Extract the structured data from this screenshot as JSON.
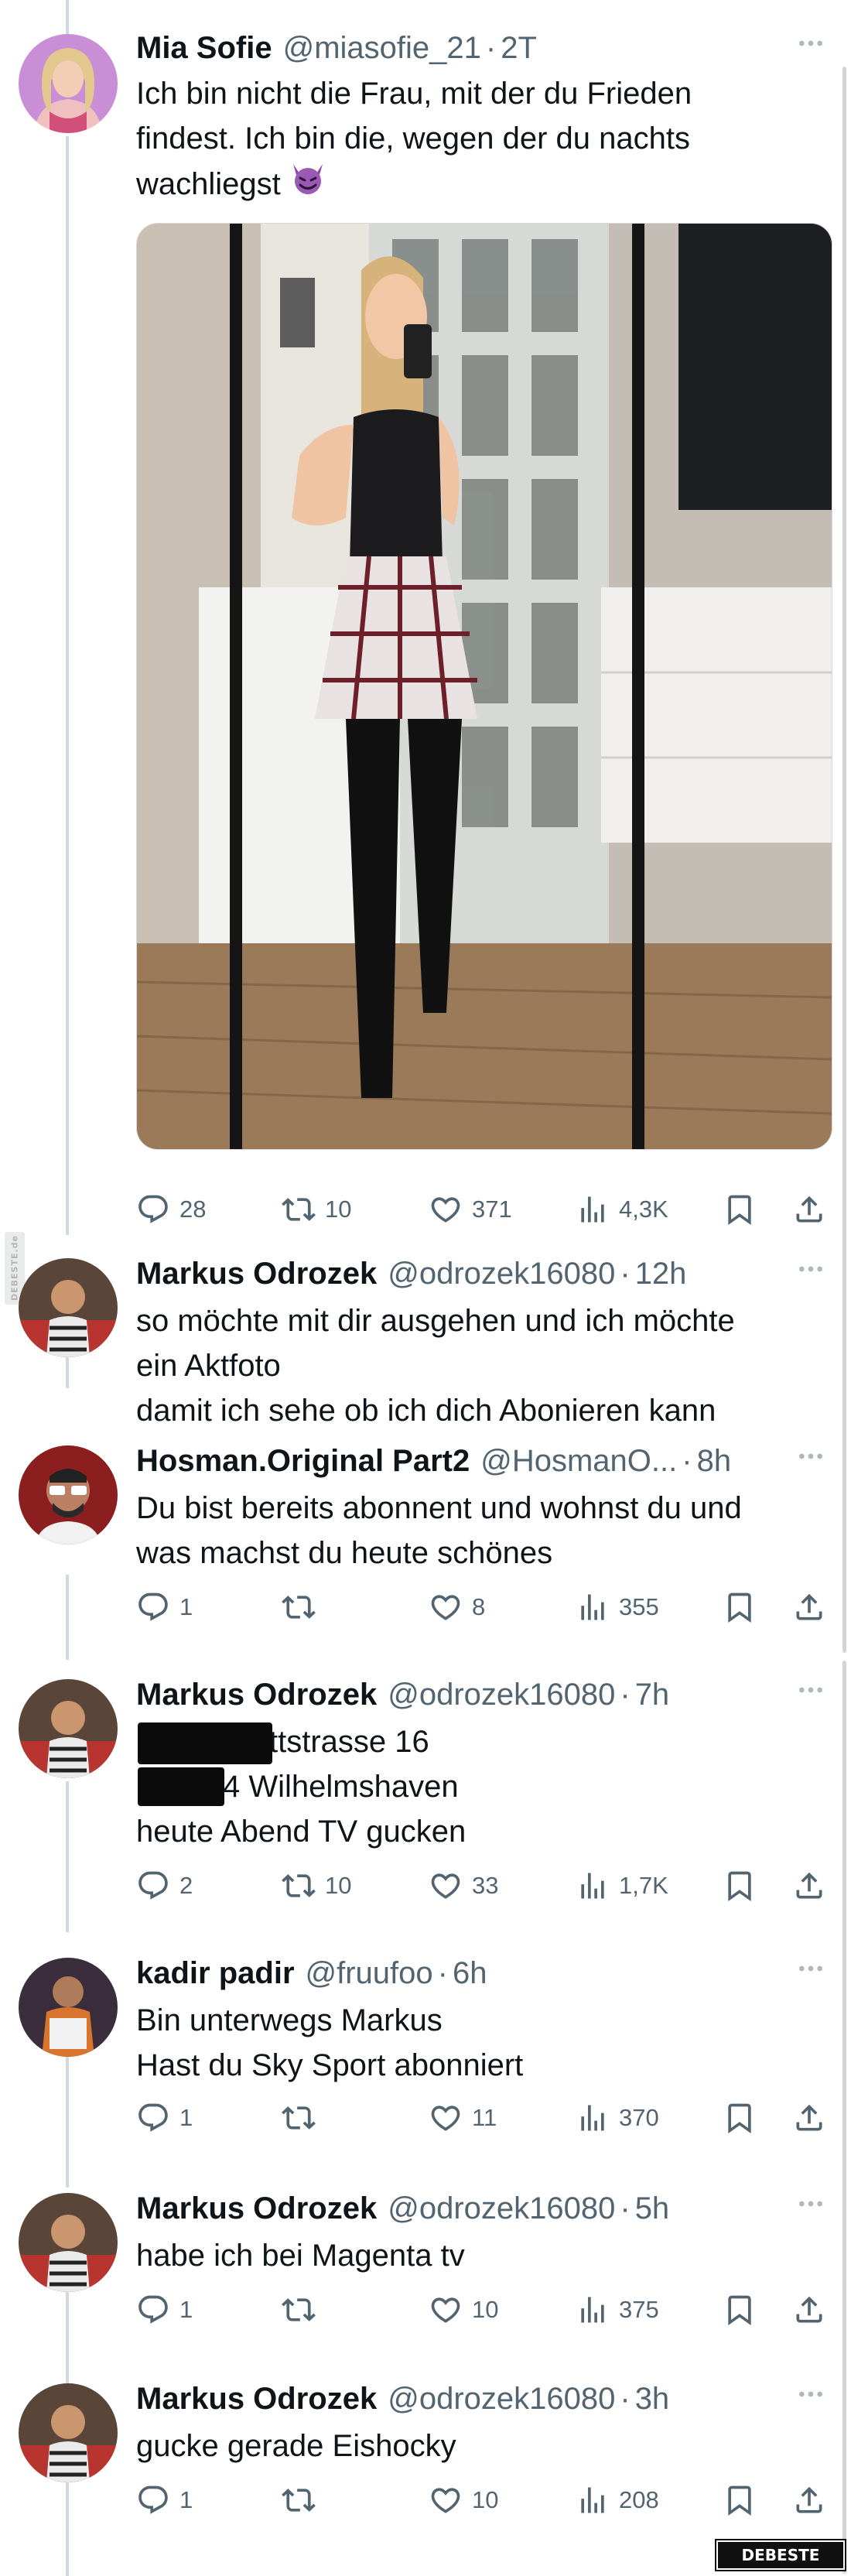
{
  "colors": {
    "text": "#0f1419",
    "muted": "#536471",
    "line": "#cfd9de",
    "background": "#ffffff"
  },
  "icons": [
    "reply-icon",
    "retweet-icon",
    "like-icon",
    "views-icon",
    "bookmark-icon",
    "share-icon",
    "more-icon",
    "devil-emoji-icon"
  ],
  "tweets": [
    {
      "name": "Mia Sofie",
      "handle": "@miasofie_21",
      "time": "2T",
      "lines": [
        "Ich bin nicht die Frau, mit der du Frieden",
        "findest. Ich bin die, wegen der du nachts",
        "wachliegst"
      ],
      "stats": {
        "replies": "28",
        "retweets": "10",
        "likes": "371",
        "views": "4,3K"
      }
    },
    {
      "name": "Markus Odrozek",
      "handle": "@odrozek16080",
      "time": "12h",
      "lines": [
        "so möchte mit dir ausgehen und ich möchte",
        "ein Aktfoto",
        "damit ich sehe ob ich dich Abonieren kann"
      ]
    },
    {
      "name": "Hosman.Original Part2",
      "handle": "@HosmanO...",
      "time": "8h",
      "lines": [
        "Du bist bereits abonnent und wohnst du und",
        "was machst du heute schönes"
      ],
      "stats": {
        "replies": "1",
        "retweets": "",
        "likes": "8",
        "views": "355"
      }
    },
    {
      "name": "Markus Odrozek",
      "handle": "@odrozek16080",
      "time": "7h",
      "lines": [
        "ttstrasse 16",
        "4 Wilhelmshaven",
        "heute Abend TV gucken"
      ],
      "stats": {
        "replies": "2",
        "retweets": "10",
        "likes": "33",
        "views": "1,7K"
      }
    },
    {
      "name": "kadir padir",
      "handle": "@fruufoo",
      "time": "6h",
      "lines": [
        "Bin unterwegs Markus",
        "Hast du Sky Sport abonniert"
      ],
      "stats": {
        "replies": "1",
        "retweets": "",
        "likes": "11",
        "views": "370"
      }
    },
    {
      "name": "Markus Odrozek",
      "handle": "@odrozek16080",
      "time": "5h",
      "lines": [
        "habe ich bei Magenta tv"
      ],
      "stats": {
        "replies": "1",
        "retweets": "",
        "likes": "10",
        "views": "375"
      }
    },
    {
      "name": "Markus Odrozek",
      "handle": "@odrozek16080",
      "time": "3h",
      "lines": [
        "gucke gerade Eishocky"
      ],
      "stats": {
        "replies": "1",
        "retweets": "",
        "likes": "10",
        "views": "208"
      }
    }
  ],
  "watermark": "DEBESTE",
  "side_watermark": "DEBESTE.de"
}
